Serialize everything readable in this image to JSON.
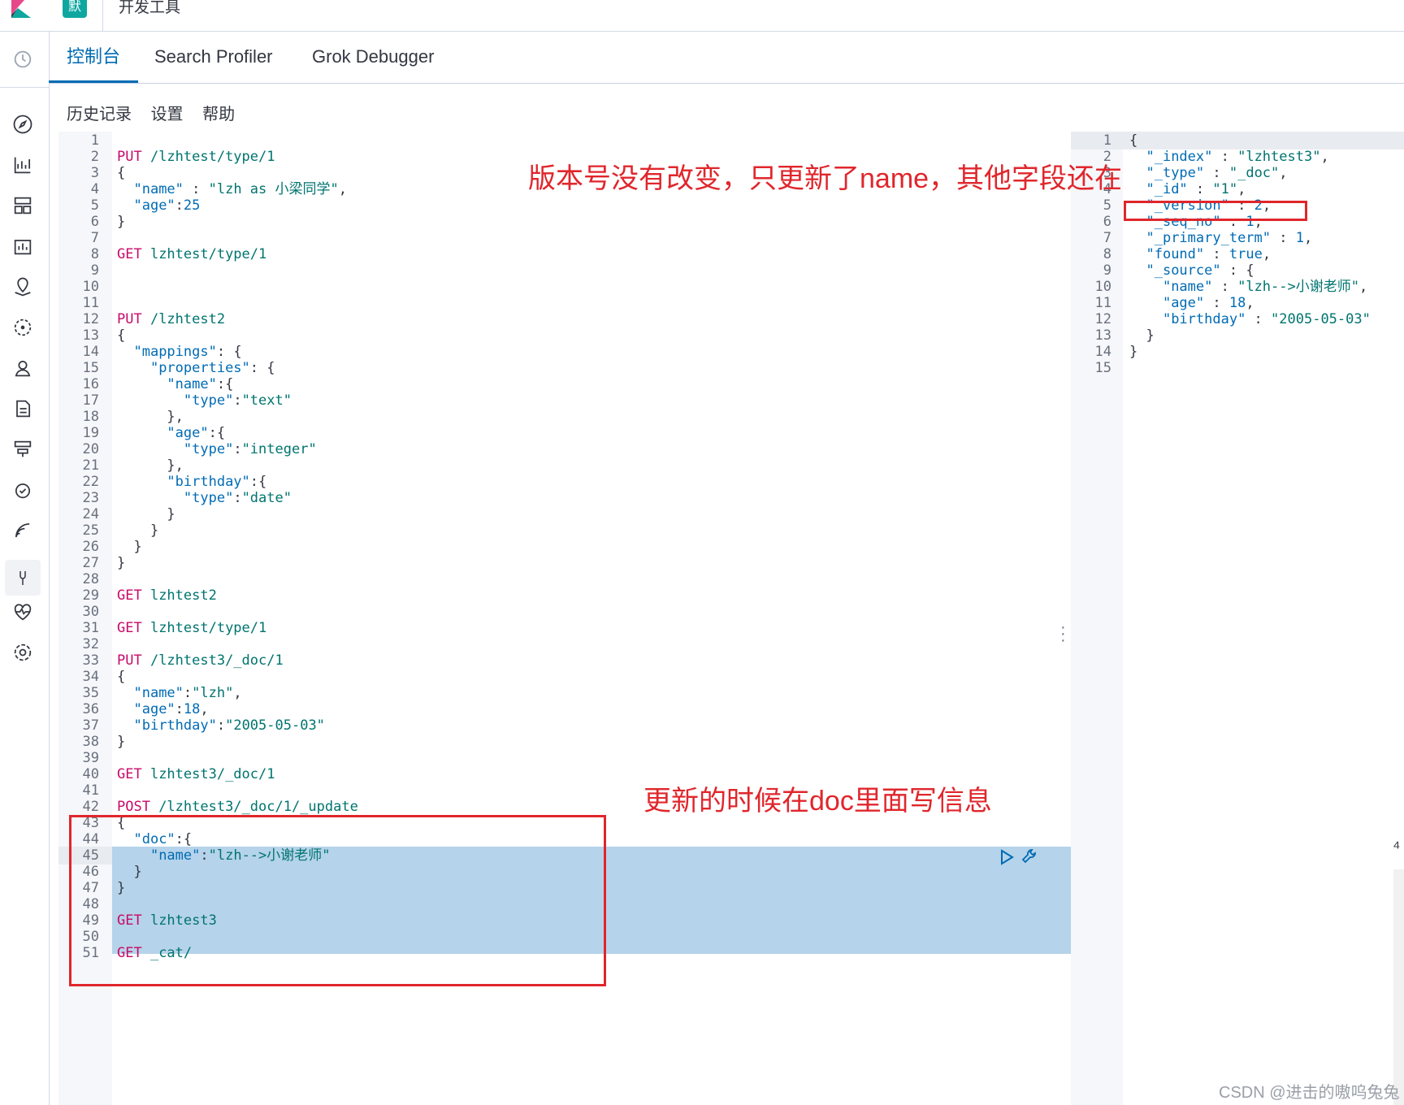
{
  "header": {
    "space_badge": "默",
    "app_title": "开发工具"
  },
  "tabs": [
    {
      "label": "控制台",
      "active": true
    },
    {
      "label": "Search Profiler",
      "active": false
    },
    {
      "label": "Grok Debugger",
      "active": false
    }
  ],
  "subnav": [
    "历史记录",
    "设置",
    "帮助"
  ],
  "colors": {
    "accent": "#006bb4",
    "annotation": "#e0262c",
    "method": "#c80a68",
    "string": "#00746f"
  },
  "annotations": {
    "top": "版本号没有改变，只更新了name，其他字段还在",
    "bottom": "更新的时候在doc里面写信息"
  },
  "request_lines": [
    "",
    "PUT /lzhtest/type/1",
    "{",
    "  \"name\" : \"lzh as 小梁同学\",",
    "  \"age\":25",
    "}",
    "",
    "GET lzhtest/type/1",
    "",
    "",
    "",
    "PUT /lzhtest2",
    "{",
    "  \"mappings\": {",
    "    \"properties\": {",
    "      \"name\":{",
    "        \"type\":\"text\"",
    "      },",
    "      \"age\":{",
    "        \"type\":\"integer\"",
    "      },",
    "      \"birthday\":{",
    "        \"type\":\"date\"",
    "      }",
    "    }",
    "  }",
    "}",
    "",
    "GET lzhtest2",
    "",
    "GET lzhtest/type/1",
    "",
    "PUT /lzhtest3/_doc/1",
    "{",
    "  \"name\":\"lzh\",",
    "  \"age\":18,",
    "  \"birthday\":\"2005-05-03\"",
    "}",
    "",
    "GET lzhtest3/_doc/1",
    "",
    "POST /lzhtest3/_doc/1/_update",
    "{",
    "  \"doc\":{",
    "    \"name\":\"lzh-->小谢老师\"",
    "  }",
    "}",
    "",
    "GET lzhtest3",
    "",
    "GET _cat/"
  ],
  "response_lines": [
    "{",
    "  \"_index\" : \"lzhtest3\",",
    "  \"_type\" : \"_doc\",",
    "  \"_id\" : \"1\",",
    "  \"_version\" : 2,",
    "  \"_seq_no\" : 1,",
    "  \"_primary_term\" : 1,",
    "  \"found\" : true,",
    "  \"_source\" : {",
    "    \"name\" : \"lzh-->小谢老师\",",
    "    \"age\" : 18,",
    "    \"birthday\" : \"2005-05-03\"",
    "  }",
    "}",
    ""
  ],
  "watermark": "CSDN @进击的嗷呜兔兔",
  "icons": [
    "clock-icon",
    "compass-icon",
    "visualize-icon",
    "dashboard-icon",
    "canvas-icon",
    "maps-icon",
    "ml-icon",
    "graph-icon",
    "logs-icon",
    "infra-icon",
    "uptime-icon",
    "apm-icon",
    "dev-tools-icon",
    "monitoring-icon",
    "settings-icon"
  ]
}
